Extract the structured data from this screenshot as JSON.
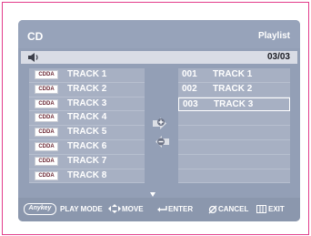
{
  "header": {
    "left_title": "CD",
    "right_title": "Playlist"
  },
  "info": {
    "position": "03/03",
    "speaker_icon": "speaker-icon"
  },
  "left_list": [
    {
      "badge": "CDDA",
      "title": "TRACK 1"
    },
    {
      "badge": "CDDA",
      "title": "TRACK 2"
    },
    {
      "badge": "CDDA",
      "title": "TRACK 3"
    },
    {
      "badge": "CDDA",
      "title": "TRACK 4"
    },
    {
      "badge": "CDDA",
      "title": "TRACK 5"
    },
    {
      "badge": "CDDA",
      "title": "TRACK 6"
    },
    {
      "badge": "CDDA",
      "title": "TRACK 7"
    },
    {
      "badge": "CDDA",
      "title": "TRACK 8"
    }
  ],
  "right_list": [
    {
      "num": "001",
      "title": "TRACK 1"
    },
    {
      "num": "002",
      "title": "TRACK 2"
    },
    {
      "num": "003",
      "title": "TRACK 3",
      "selected": true
    }
  ],
  "footer": {
    "anykey": "Anykey",
    "play_mode": "PLAY MODE",
    "move": "MOVE",
    "enter": "ENTER",
    "cancel": "CANCEL",
    "exit": "EXIT"
  },
  "colors": {
    "accent": "#e33c8b",
    "panel": "#939fb6",
    "row": "#a7b0c3"
  }
}
